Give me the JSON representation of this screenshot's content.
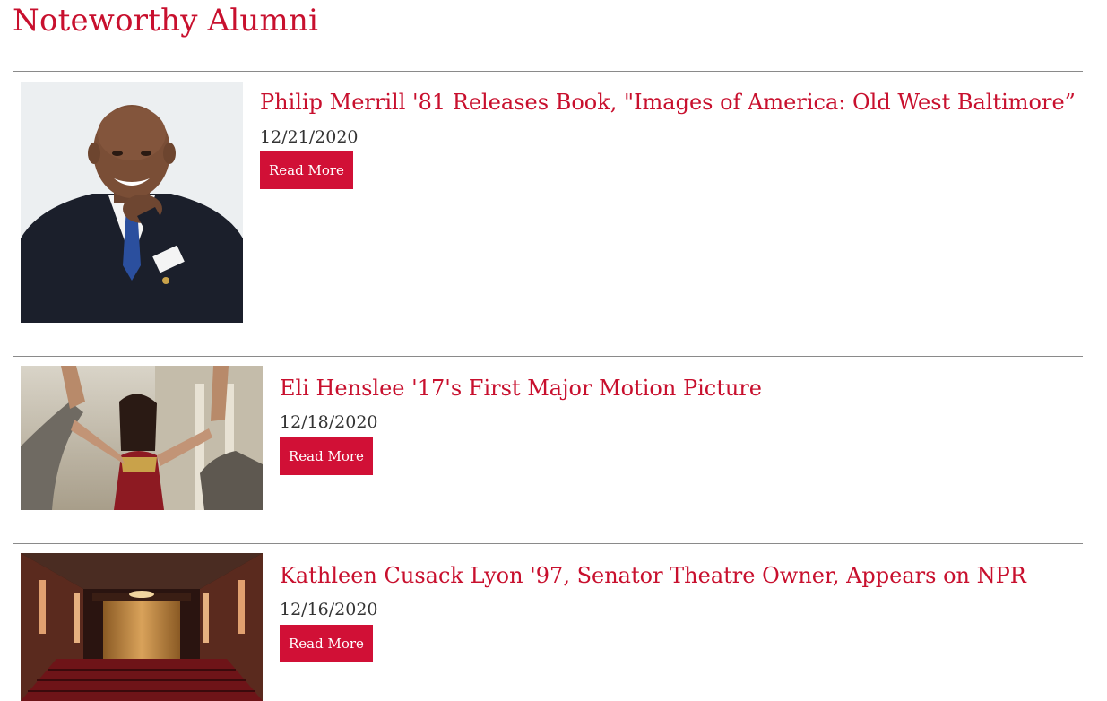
{
  "page": {
    "title": "Noteworthy Alumni"
  },
  "colors": {
    "accent": "#c8102e",
    "button": "#d11036",
    "divider": "#8a8a8a",
    "date_text": "#333333"
  },
  "articles": [
    {
      "headline": "Philip Merrill '81 Releases Book, \"Images of America: Old West Baltimore”",
      "date": "12/21/2020",
      "read_more": "Read More",
      "image": "portrait-photo"
    },
    {
      "headline": "Eli Henslee '17's First Major Motion Picture",
      "date": "12/18/2020",
      "read_more": "Read More",
      "image": "movie-still-photo"
    },
    {
      "headline": "Kathleen Cusack Lyon '97, Senator Theatre Owner, Appears on NPR",
      "date": "12/16/2020",
      "read_more": "Read More",
      "image": "theatre-interior-photo"
    }
  ]
}
